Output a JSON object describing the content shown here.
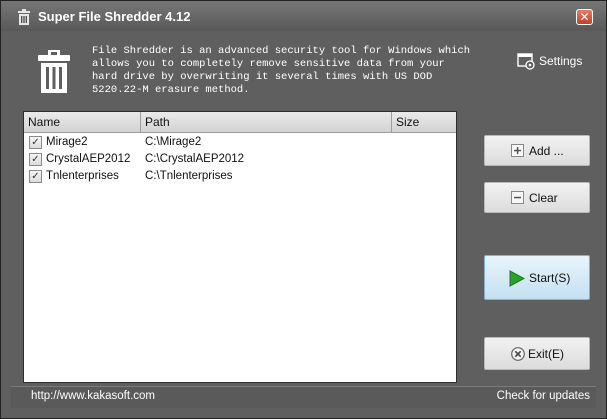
{
  "window": {
    "title": "Super File Shredder 4.12",
    "close_glyph": "✕"
  },
  "header": {
    "description": "File Shredder is an advanced security tool for Windows which\nallows you to completely remove sensitive data from your\nhard drive by overwriting it several times with US DOD\n5220.22-M erasure method.",
    "settings_label": "Settings",
    "trash_icon": "trash-icon",
    "settings_icon": "settings-icon"
  },
  "filelist": {
    "columns": [
      "Name",
      "Path",
      "Size"
    ],
    "rows": [
      {
        "name": "Mirage2",
        "path": "C:\\Mirage2",
        "size": "",
        "checked": true
      },
      {
        "name": "CrystalAEP2012",
        "path": "C:\\CrystalAEP2012",
        "size": "",
        "checked": true
      },
      {
        "name": "Tnlenterprises",
        "path": "C:\\Tnlenterprises",
        "size": "",
        "checked": true
      }
    ],
    "check_glyph": "✓"
  },
  "buttons": {
    "add_label": "Add ...",
    "clear_label": "Clear",
    "start_label": "Start(S)",
    "exit_label": "Exit(E)",
    "start_accent": "#2aa12a",
    "exit_icon": "close-circle-icon"
  },
  "statusbar": {
    "url": "http://www.kakasoft.com",
    "update_label": "Check for updates"
  },
  "colors": {
    "window_bg": "#5f5f5f",
    "list_bg": "#ffffff",
    "start_button_bg": "#c4e0f1"
  }
}
